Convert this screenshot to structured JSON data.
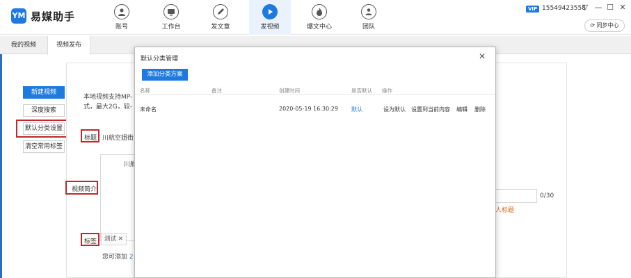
{
  "app": {
    "name": "易媒助手",
    "logo_text": "YM",
    "nav": [
      {
        "label": "账号",
        "icon": "user-icon"
      },
      {
        "label": "工作台",
        "icon": "desk-icon"
      },
      {
        "label": "发文章",
        "icon": "pen-icon"
      },
      {
        "label": "发视频",
        "icon": "play-icon"
      },
      {
        "label": "爆文中心",
        "icon": "fire-icon"
      },
      {
        "label": "团队",
        "icon": "team-icon"
      }
    ],
    "active_nav": "发视频",
    "vip_label": "VIP",
    "account_number": "15549423558",
    "window_controls": {
      "menu": "▽",
      "minimize": "—",
      "maximize": "☐",
      "close": "✕"
    },
    "sync_label": "同步中心"
  },
  "tabs": [
    {
      "label": "我的视频",
      "active": false
    },
    {
      "label": "视频发布",
      "active": true
    }
  ],
  "side_buttons": {
    "new_video": "新建视频",
    "deep_search": "深度搜索",
    "default_category": "默认分类设置",
    "clear_tags": "清空常用标签"
  },
  "background_form": {
    "intro_line1": "本地视频支持MP-",
    "intro_line2": "式，最大2G，较-",
    "title_label": "标题",
    "title_value": "川航空姐街",
    "desc_label": "视频简介",
    "desc_value": "川航",
    "tags_label": "标签",
    "tag_chip": "测试",
    "tag_hint": "您可添加",
    "tag_hint_num": "2",
    "counter": "0/30",
    "right_fragment_1": "人标题"
  },
  "modal": {
    "title": "默认分类管理",
    "add_button": "添加分类方案",
    "columns": [
      "名称",
      "备注",
      "创建时间",
      "是否默认",
      "操作"
    ],
    "rows": [
      {
        "name": "未命名",
        "note": "",
        "created": "2020-05-19 16:30:29",
        "is_default": "默认",
        "actions": [
          "设为默认",
          "设置到当前内容",
          "编辑",
          "删除"
        ]
      }
    ]
  },
  "colors": {
    "accent": "#1f7ae0",
    "highlight_red": "#c0282b",
    "left_strip": "#2b6cc4"
  }
}
